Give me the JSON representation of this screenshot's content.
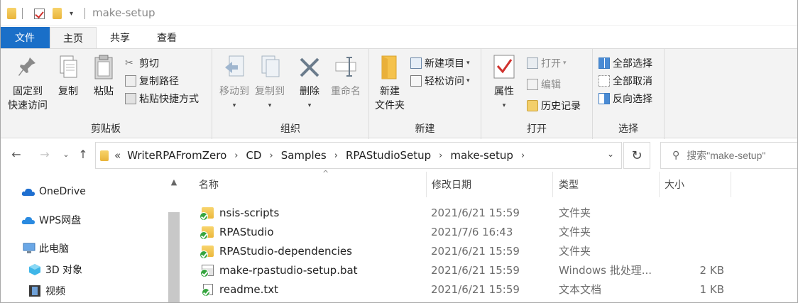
{
  "window": {
    "title": "make-setup"
  },
  "ribbon_tabs": [
    "文件",
    "主页",
    "共享",
    "查看"
  ],
  "ribbon": {
    "clipboard": {
      "pin": [
        "固定到",
        "快速访问"
      ],
      "copy": "复制",
      "paste": "粘贴",
      "cut": "剪切",
      "copy_path": "复制路径",
      "paste_shortcut": "粘贴快捷方式",
      "label": "剪贴板"
    },
    "organize": {
      "move_to": "移动到",
      "copy_to": "复制到",
      "delete": "删除",
      "rename": "重命名",
      "label": "组织"
    },
    "new": {
      "new_folder": [
        "新建",
        "文件夹"
      ],
      "new_item": "新建项目",
      "easy_access": "轻松访问",
      "label": "新建"
    },
    "open": {
      "properties": "属性",
      "open": "打开",
      "edit": "编辑",
      "history": "历史记录",
      "label": "打开"
    },
    "select": {
      "select_all": "全部选择",
      "select_none": "全部取消",
      "invert": "反向选择",
      "label": "选择"
    }
  },
  "address": {
    "prefix": "«",
    "crumbs": [
      "WriteRPAFromZero",
      "CD",
      "Samples",
      "RPAStudioSetup",
      "make-setup"
    ],
    "search_placeholder": "搜索\"make-setup\""
  },
  "nav_pane": [
    "OneDrive",
    "WPS网盘",
    "此电脑",
    "3D 对象",
    "视频"
  ],
  "columns": [
    "名称",
    "修改日期",
    "类型",
    "大小"
  ],
  "files": [
    {
      "name": "nsis-scripts",
      "date": "2021/6/21 15:59",
      "type": "文件夹",
      "size": "",
      "kind": "folder"
    },
    {
      "name": "RPAStudio",
      "date": "2021/7/6 16:43",
      "type": "文件夹",
      "size": "",
      "kind": "folder"
    },
    {
      "name": "RPAStudio-dependencies",
      "date": "2021/6/21 15:59",
      "type": "文件夹",
      "size": "",
      "kind": "folder"
    },
    {
      "name": "make-rpastudio-setup.bat",
      "date": "2021/6/21 15:59",
      "type": "Windows 批处理...",
      "size": "2 KB",
      "kind": "bat"
    },
    {
      "name": "readme.txt",
      "date": "2021/6/21 15:59",
      "type": "文本文档",
      "size": "1 KB",
      "kind": "txt"
    }
  ],
  "colors": {
    "accent": "#1a6fc8",
    "ribbon_bg": "#f3f3f3",
    "sync_green": "#36a53f"
  }
}
